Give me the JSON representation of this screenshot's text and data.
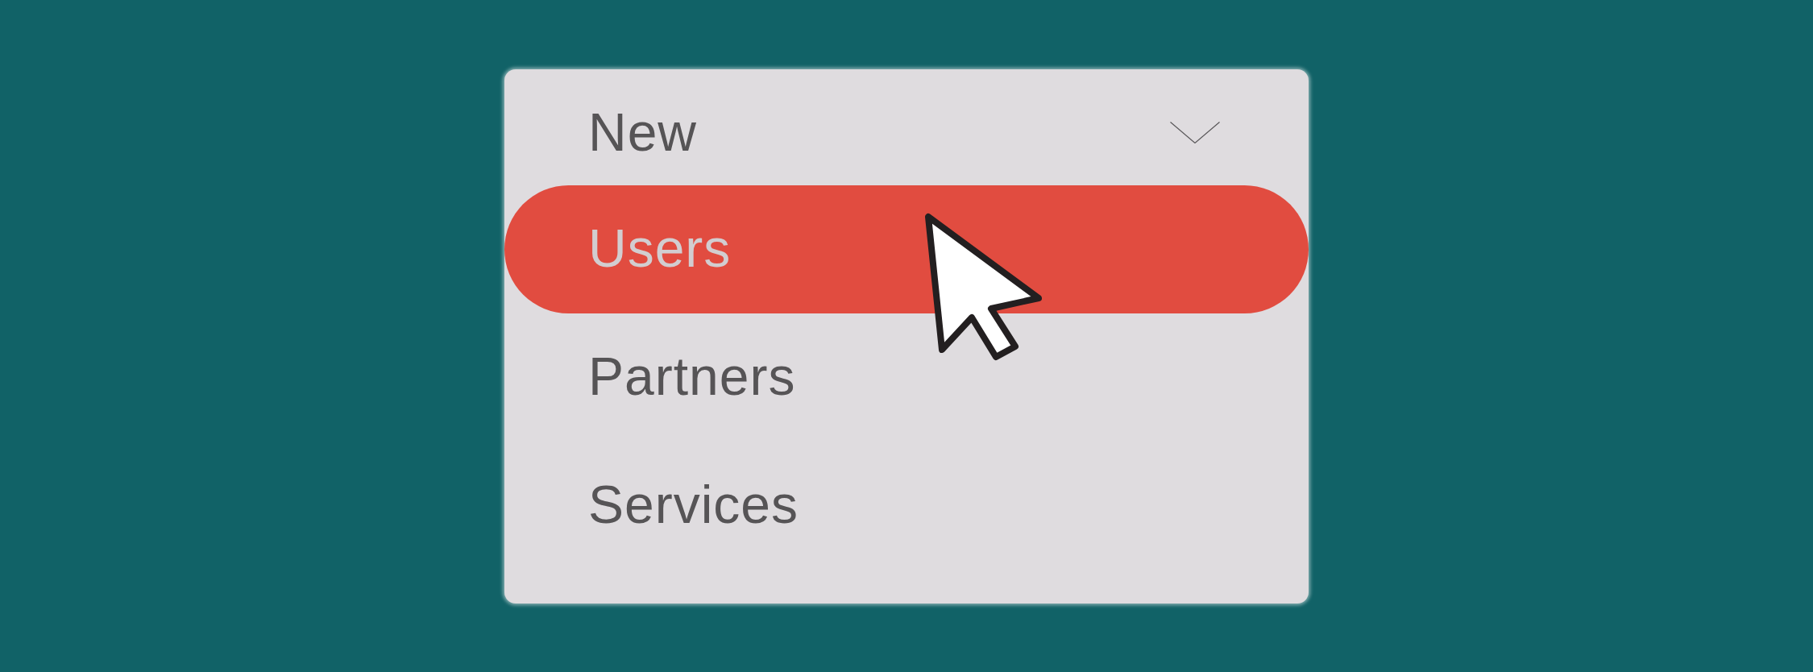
{
  "dropdown": {
    "label": "New",
    "items": [
      {
        "label": "Users",
        "selected": true
      },
      {
        "label": "Partners",
        "selected": false
      },
      {
        "label": "Services",
        "selected": false
      }
    ]
  }
}
